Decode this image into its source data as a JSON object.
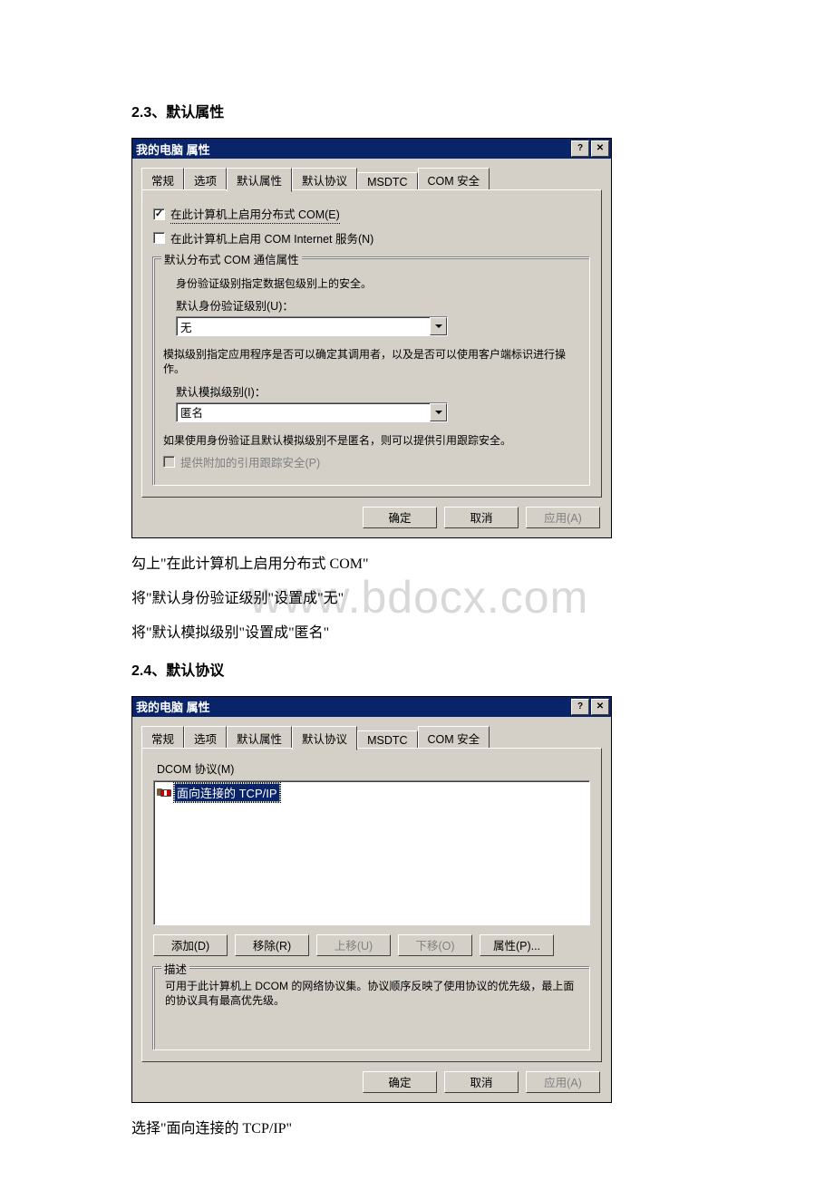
{
  "headings": {
    "s23": "2.3、默认属性",
    "s24": "2.4、默认协议"
  },
  "dialog1": {
    "title": "我的电脑 属性",
    "tabs": [
      "常规",
      "选项",
      "默认属性",
      "默认协议",
      "MSDTC",
      "COM 安全"
    ],
    "active_tab": 2,
    "chk_enable_dcom": "在此计算机上启用分布式 COM(E)",
    "chk_enable_internet": "在此计算机上启用 COM Internet 服务(N)",
    "fieldset_legend": "默认分布式 COM 通信属性",
    "auth_desc": "身份验证级别指定数据包级别上的安全。",
    "auth_label": "默认身份验证级别(U)：",
    "auth_value": "无",
    "imp_desc": "模拟级别指定应用程序是否可以确定其调用者，以及是否可以使用客户端标识进行操作。",
    "imp_label": "默认模拟级别(I)：",
    "imp_value": "匿名",
    "track_desc": "如果使用身份验证且默认模拟级别不是匿名，则可以提供引用跟踪安全。",
    "track_chk": "提供附加的引用跟踪安全(P)",
    "ok": "确定",
    "cancel": "取消",
    "apply": "应用(A)"
  },
  "notes1": {
    "l1": "勾上\"在此计算机上启用分布式 COM\"",
    "l2": "将\"默认身份验证级别\"设置成\"无\"",
    "l3": "将\"默认模拟级别\"设置成\"匿名\""
  },
  "watermark": "www.bdocx.com",
  "dialog2": {
    "title": "我的电脑 属性",
    "tabs": [
      "常规",
      "选项",
      "默认属性",
      "默认协议",
      "MSDTC",
      "COM 安全"
    ],
    "active_tab": 3,
    "list_label": "DCOM 协议(M)",
    "list_item": "面向连接的 TCP/IP",
    "add": "添加(D)",
    "remove": "移除(R)",
    "up": "上移(U)",
    "down": "下移(O)",
    "props": "属性(P)...",
    "fieldset_legend": "描述",
    "desc": "可用于此计算机上 DCOM 的网络协议集。协议顺序反映了使用协议的优先级，最上面的协议具有最高优先级。",
    "ok": "确定",
    "cancel": "取消",
    "apply": "应用(A)"
  },
  "notes2": {
    "l1": "选择\"面向连接的 TCP/IP\""
  }
}
